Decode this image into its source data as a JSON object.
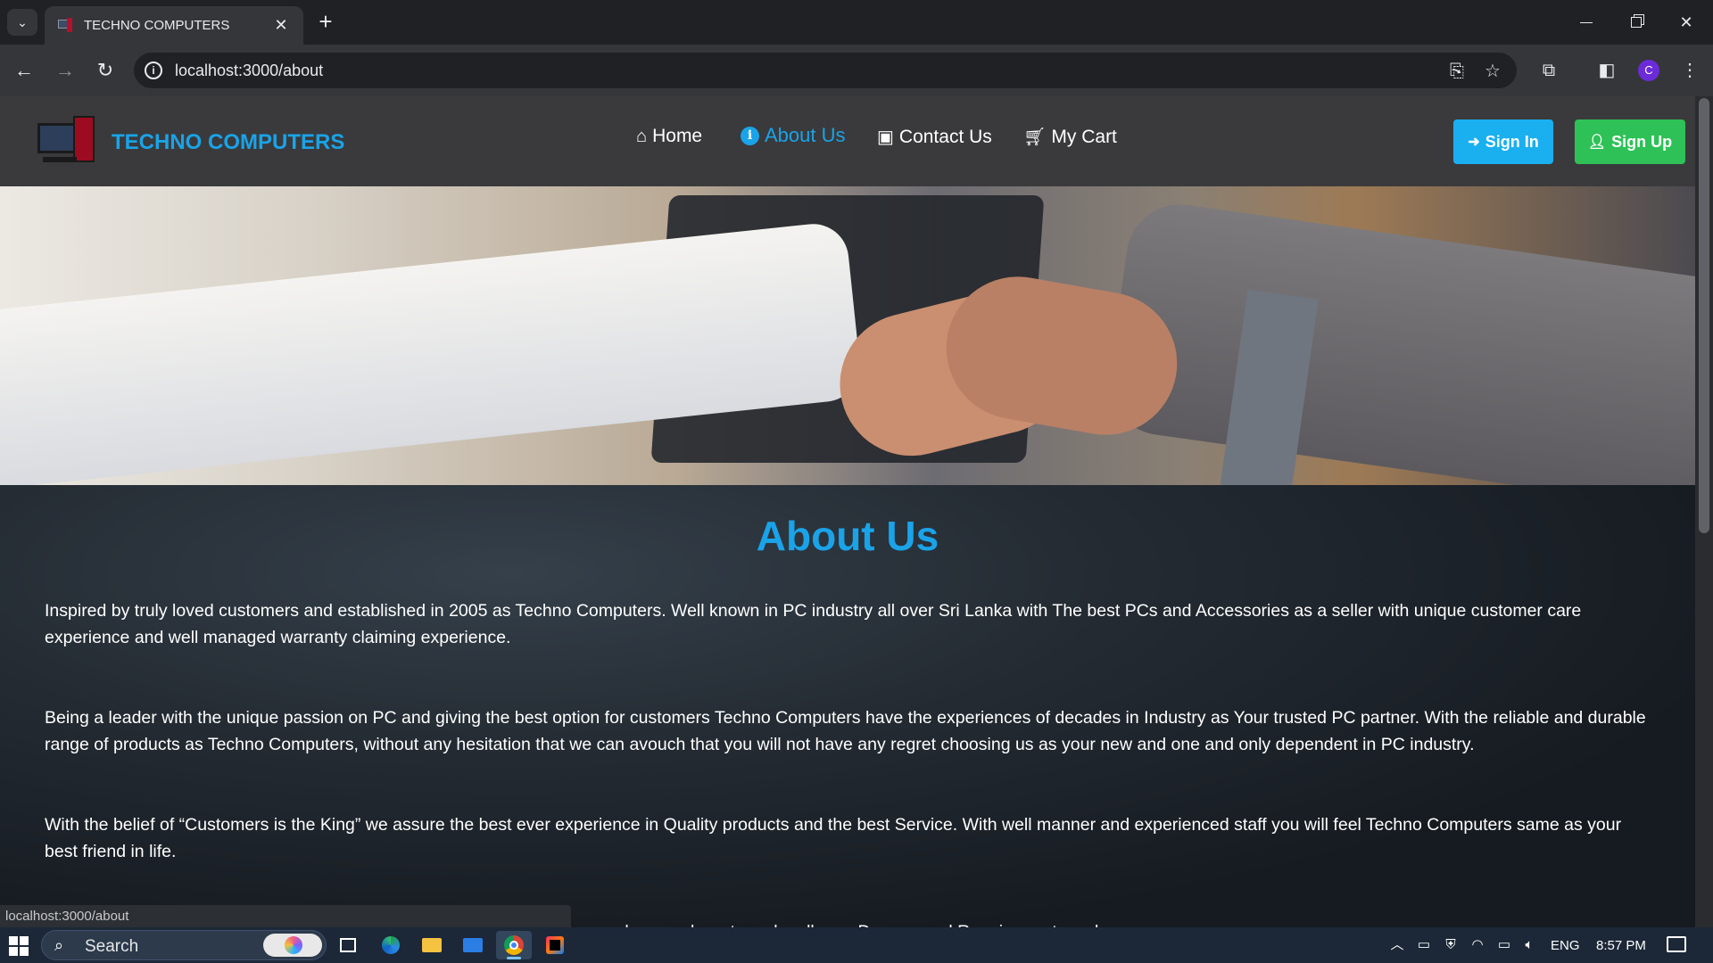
{
  "browser": {
    "tab_title": "TECHNO COMPUTERS",
    "url": "localhost:3000/about",
    "profile_initial": "C",
    "status_url": "localhost:3000/about"
  },
  "site": {
    "brand": "TECHNO COMPUTERS",
    "nav": {
      "home": "Home",
      "about": "About Us",
      "contact": "Contact Us",
      "cart": "My Cart"
    },
    "sign_in": "Sign In",
    "sign_up": "Sign Up",
    "brand_color": "#1aa3e8",
    "signin_color": "#1ab0f0",
    "signup_color": "#2ec157"
  },
  "about": {
    "title": "About Us",
    "paragraphs": [
      "Inspired by truly loved customers and established in 2005 as Techno Computers. Well known in PC industry all over Sri Lanka with The best PCs and Accessories as a seller with unique customer care experience and well managed warranty claiming experience.",
      "Being a leader with the unique passion on PC and giving the best option for customers Techno Computers have the experiences of decades in Industry as Your trusted PC partner. With the reliable and durable range of products as Techno Computers, without any hesitation that we can avouch that you will not have any regret choosing us as your new and one and only dependent in PC industry.",
      "With the belief of “Customers is the King” we assure the best ever experience in Quality products and the best Service. With well manner and experienced staff you will feel Techno Computers same as your best friend in life.",
      "…th the future world with the best possible ways with field of computers and we are here to make all your Dreams and Requirements make"
    ]
  },
  "taskbar": {
    "search_label": "Search",
    "language": "ENG",
    "time": "8:57 PM"
  }
}
